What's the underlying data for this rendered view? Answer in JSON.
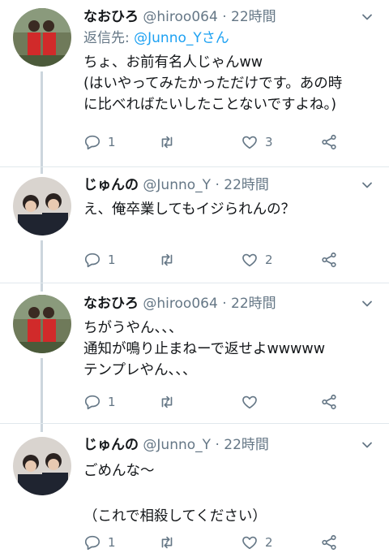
{
  "tweets": [
    {
      "name": "なおひろ",
      "handle": "@hiroo064",
      "sep": "·",
      "time": "22時間",
      "reply_prefix": "返信先: ",
      "reply_to": "@Junno_Yさん",
      "lines": [
        "ちょ、お前有名人じゃんww",
        "(はいやってみたかっただけです。あの時",
        "に比べればたいしたことないですよね。)"
      ],
      "replies": "1",
      "retweets": "",
      "likes": "3"
    },
    {
      "name": "じゅんの",
      "handle": "@Junno_Y",
      "sep": "·",
      "time": "22時間",
      "lines": [
        "え、俺卒業してもイジられんの？"
      ],
      "replies": "1",
      "retweets": "",
      "likes": "2"
    },
    {
      "name": "なおひろ",
      "handle": "@hiroo064",
      "sep": "·",
      "time": "22時間",
      "lines": [
        "ちがうやん、、、",
        "通知が鳴り止まねーで返せよwwwww",
        "テンプレやん、、、"
      ],
      "replies": "1",
      "retweets": "",
      "likes": ""
    },
    {
      "name": "じゅんの",
      "handle": "@Junno_Y",
      "sep": "·",
      "time": "22時間",
      "lines": [
        "ごめんな〜",
        "",
        "（これで相殺してください）"
      ],
      "replies": "1",
      "retweets": "",
      "likes": "2"
    }
  ],
  "colors": {
    "text": "#14171a",
    "muted": "#657786",
    "link": "#1da1f2",
    "thread": "#ccd6dd",
    "divider": "#e1e8ed"
  },
  "icons": [
    "reply-icon",
    "retweet-icon",
    "like-icon",
    "share-icon",
    "caret-down-icon"
  ]
}
